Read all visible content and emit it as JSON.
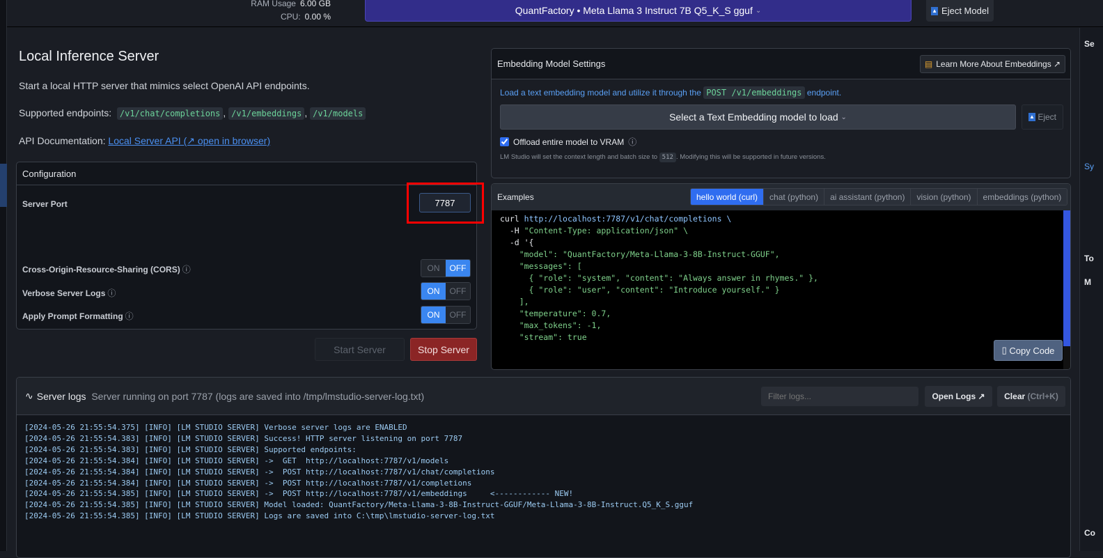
{
  "topbar": {
    "ram_label": "RAM Usage",
    "ram_value": "6.00 GB",
    "cpu_label": "CPU:",
    "cpu_value": "0.00 %",
    "model": "QuantFactory • Meta Llama 3 Instruct 7B Q5_K_S gguf",
    "eject": "Eject Model"
  },
  "server": {
    "title": "Local Inference Server",
    "desc": "Start a local HTTP server that mimics select OpenAI API endpoints.",
    "endpoints_label": "Supported endpoints:",
    "endpoints": [
      "/v1/chat/completions",
      "/v1/embeddings",
      "/v1/models"
    ],
    "docs_label": "API Documentation:",
    "docs_link": "Local Server API (↗ open in browser)"
  },
  "config": {
    "title": "Configuration",
    "port_label": "Server Port",
    "port_value": "7787",
    "cors_label": "Cross-Origin-Resource-Sharing (CORS)",
    "cors_on": false,
    "verbose_label": "Verbose Server Logs",
    "verbose_on": true,
    "prompt_label": "Apply Prompt Formatting",
    "prompt_on": true,
    "on": "ON",
    "off": "OFF",
    "start": "Start Server",
    "stop": "Stop Server"
  },
  "embedding": {
    "title": "Embedding Model Settings",
    "learn": "Learn More About Embeddings ↗",
    "desc_pre": "Load a text embedding model and utilize it through the",
    "desc_code": "POST /v1/embeddings",
    "desc_post": "endpoint.",
    "select": "Select a Text Embedding model to load",
    "eject": "Eject",
    "offload": "Offload entire model to VRAM",
    "offload_checked": true,
    "note_pre": "LM Studio will set the context length and batch size to",
    "note_code": "512",
    "note_post": ". Modifying this will be supported in future versions."
  },
  "examples": {
    "title": "Examples",
    "tabs": [
      "hello world (curl)",
      "chat (python)",
      "ai assistant (python)",
      "vision (python)",
      "embeddings (python)"
    ],
    "active_tab": 0,
    "copy": "Copy Code",
    "code": [
      "curl",
      "http://localhost:7787/v1/chat/completions \\",
      "  -H",
      "\"Content-Type: application/json\" \\",
      "  -d '{",
      "    \"model\": \"QuantFactory/Meta-Llama-3-8B-Instruct-GGUF\",",
      "    \"messages\": [",
      "      { \"role\": \"system\", \"content\": \"Always answer in rhymes.\" },",
      "      { \"role\": \"user\", \"content\": \"Introduce yourself.\" }",
      "    ],",
      "    \"temperature\": 0.7,",
      "    \"max_tokens\": -1,",
      "    \"stream\": true"
    ]
  },
  "logs": {
    "title": "Server logs",
    "status": "Server running on port 7787 (logs are saved into /tmp/lmstudio-server-log.txt)",
    "filter_placeholder": "Filter logs...",
    "open": "Open Logs ↗",
    "clear": "Clear",
    "clear_hint": "(Ctrl+K)",
    "lines": [
      "[2024-05-26 21:55:54.375] [INFO] [LM STUDIO SERVER] Verbose server logs are ENABLED",
      "[2024-05-26 21:55:54.383] [INFO] [LM STUDIO SERVER] Success! HTTP server listening on port 7787",
      "[2024-05-26 21:55:54.383] [INFO] [LM STUDIO SERVER] Supported endpoints:",
      "[2024-05-26 21:55:54.384] [INFO] [LM STUDIO SERVER] ->  GET  http://localhost:7787/v1/models",
      "[2024-05-26 21:55:54.384] [INFO] [LM STUDIO SERVER] ->  POST http://localhost:7787/v1/chat/completions",
      "[2024-05-26 21:55:54.384] [INFO] [LM STUDIO SERVER] ->  POST http://localhost:7787/v1/completions",
      "[2024-05-26 21:55:54.385] [INFO] [LM STUDIO SERVER] ->  POST http://localhost:7787/v1/embeddings     <------------ NEW!",
      "[2024-05-26 21:55:54.385] [INFO] [LM STUDIO SERVER] Model loaded: QuantFactory/Meta-Llama-3-8B-Instruct-GGUF/Meta-Llama-3-8B-Instruct.Q5_K_S.gguf",
      "[2024-05-26 21:55:54.385] [INFO] [LM STUDIO SERVER] Logs are saved into C:\\tmp\\lmstudio-server-log.txt"
    ]
  },
  "right_panel": {
    "labels": [
      "Se",
      "Sy",
      "To",
      "M",
      "Co"
    ]
  },
  "colors": {
    "accent": "#3a86f0",
    "model_bar": "#322d8a",
    "stop": "#8b2525",
    "highlight": "#ff0000"
  }
}
